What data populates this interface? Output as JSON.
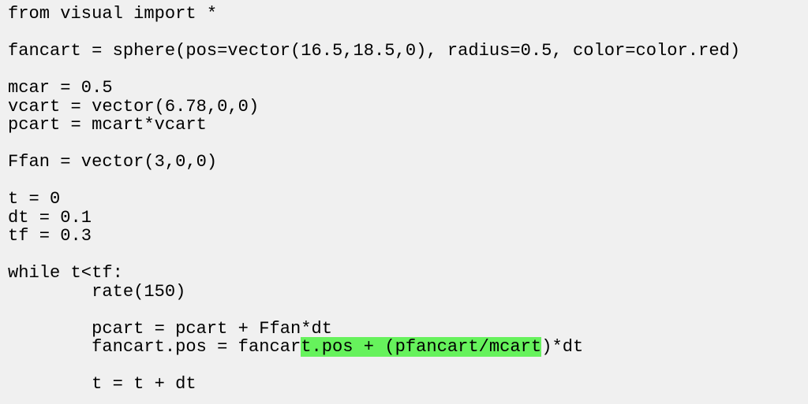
{
  "editor": {
    "background": "#f0f0f0",
    "highlight_color": "#66f25c",
    "lines": [
      {
        "text": "from visual import *"
      },
      {
        "text": ""
      },
      {
        "text": "fancart = sphere(pos=vector(16.5,18.5,0), radius=0.5, color=color.red)"
      },
      {
        "text": ""
      },
      {
        "text": "mcar = 0.5"
      },
      {
        "text": "vcart = vector(6.78,0,0)"
      },
      {
        "text": "pcart = mcart*vcart"
      },
      {
        "text": ""
      },
      {
        "text": "Ffan = vector(3,0,0)"
      },
      {
        "text": ""
      },
      {
        "text": "t = 0"
      },
      {
        "text": "dt = 0.1"
      },
      {
        "text": "tf = 0.3"
      },
      {
        "text": ""
      },
      {
        "text": "while t<tf:"
      },
      {
        "text": "        rate(150)"
      },
      {
        "text": ""
      },
      {
        "text": "        pcart = pcart + Ffan*dt"
      },
      {
        "text": "        fancart.pos = fancar",
        "highlight": "t.pos + (pfancart/mcart",
        "after": ")*dt"
      },
      {
        "text": ""
      },
      {
        "text": "        t = t + dt"
      }
    ]
  }
}
